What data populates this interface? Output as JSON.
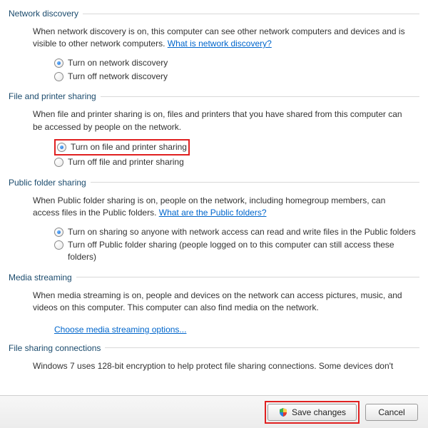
{
  "sections": {
    "network_discovery": {
      "title": "Network discovery",
      "desc_a": "When network discovery is on, this computer can see other network computers and devices and is visible to other network computers. ",
      "link": "What is network discovery?",
      "opt_on": "Turn on network discovery",
      "opt_off": "Turn off network discovery"
    },
    "file_printer": {
      "title": "File and printer sharing",
      "desc": "When file and printer sharing is on, files and printers that you have shared from this computer can be accessed by people on the network.",
      "opt_on": "Turn on file and printer sharing",
      "opt_off": "Turn off file and printer sharing"
    },
    "public_folder": {
      "title": "Public folder sharing",
      "desc_a": "When Public folder sharing is on, people on the network, including homegroup members, can access files in the Public folders. ",
      "link": "What are the Public folders?",
      "opt_on": "Turn on sharing so anyone with network access can read and write files in the Public folders",
      "opt_off": "Turn off Public folder sharing (people logged on to this computer can still access these folders)"
    },
    "media_streaming": {
      "title": "Media streaming",
      "desc": "When media streaming is on, people and devices on the network can access pictures, music, and videos on this computer. This computer can also find media on the network.",
      "link": "Choose media streaming options..."
    },
    "file_sharing_conn": {
      "title": "File sharing connections",
      "desc": "Windows 7 uses 128-bit encryption to help protect file sharing connections. Some devices don't"
    }
  },
  "footer": {
    "save": "Save changes",
    "cancel": "Cancel"
  }
}
